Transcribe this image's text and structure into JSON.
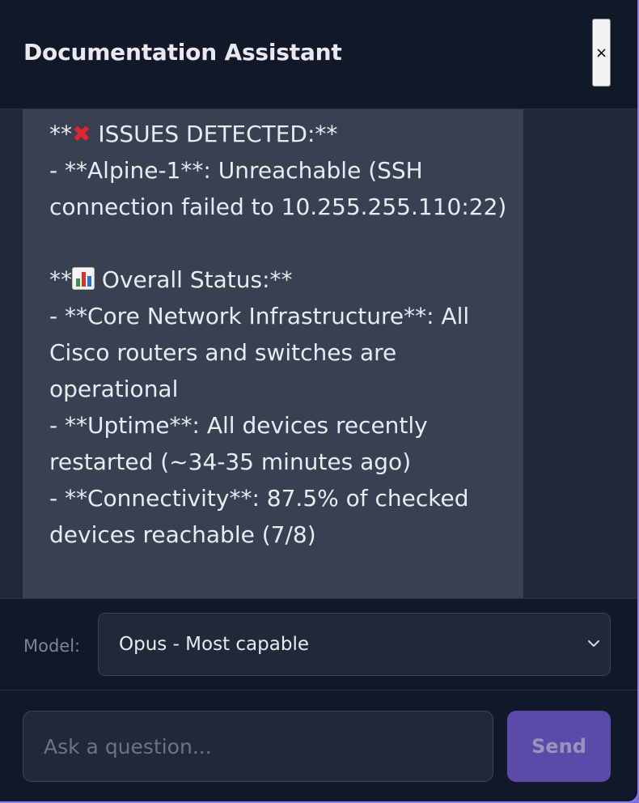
{
  "header": {
    "title": "Documentation Assistant",
    "close_label": "×"
  },
  "message": {
    "issues_prefix": "**",
    "issues_title": " ISSUES DETECTED:**",
    "issues_line": "- **Alpine-1**: Unreachable (SSH connection failed to 10.255.255.110:22)",
    "status_prefix": "**",
    "status_title": " Overall Status:**",
    "status_line_1": "- **Core Network Infrastructure**: All Cisco routers and switches are operational",
    "status_line_2": "- **Uptime**: All devices recently restarted (~34-35 minutes ago)",
    "status_line_3": "- **Connectivity**: 87.5% of checked devices reachable (7/8)",
    "icons": {
      "issues": "cross-mark-icon",
      "status": "bar-chart-icon"
    },
    "colors": {
      "cross_mark": "#e0252e"
    }
  },
  "model": {
    "label": "Model:",
    "selected": "Opus - Most capable"
  },
  "composer": {
    "placeholder": "Ask a question...",
    "send_label": "Send"
  },
  "colors": {
    "panel_bg": "#111827",
    "message_area_bg": "#1f2937",
    "bubble_bg": "#374151",
    "send_button_bg": "#5b4aa8",
    "accent_border": "#8b7cf0"
  }
}
